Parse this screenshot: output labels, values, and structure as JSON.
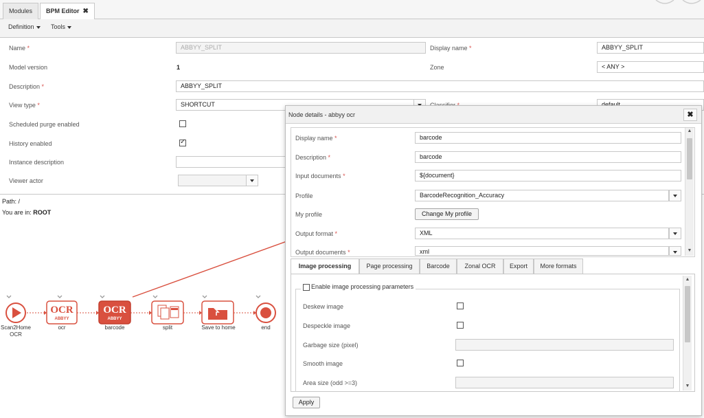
{
  "tabs": [
    {
      "label": "Modules"
    },
    {
      "label": "BPM Editor",
      "close": "✖"
    }
  ],
  "toolbar": {
    "definition": "Definition",
    "tools": "Tools"
  },
  "form": {
    "name_label": "Name",
    "name_value": "ABBYY_SPLIT",
    "display_name_label": "Display name",
    "display_name_value": "ABBYY_SPLIT",
    "model_version_label": "Model version",
    "model_version_value": "1",
    "zone_label": "Zone",
    "zone_value": "< ANY >",
    "description_label": "Description",
    "description_value": "ABBYY_SPLIT",
    "view_type_label": "View type",
    "view_type_value": "SHORTCUT",
    "classifier_label": "Classifier",
    "classifier_value": "default",
    "scheduled_purge_label": "Scheduled purge enabled",
    "scheduled_purge_checked": false,
    "history_label": "History enabled",
    "history_checked": true,
    "instance_description_label": "Instance description",
    "viewer_actor_label": "Viewer actor",
    "required_mark": "*"
  },
  "path": {
    "path_text": "Path: /",
    "you_are_in_label": "You are in:",
    "you_are_in_value": "ROOT"
  },
  "flow": {
    "nodes": [
      {
        "label": "Scan2Home OCR",
        "icon": "play-start-icon"
      },
      {
        "label": "ocr",
        "icon": "abbyy-ocr-icon",
        "title": "OCR",
        "sub": "ABBYY"
      },
      {
        "label": "barcode",
        "icon": "abbyy-ocr-icon",
        "title": "OCR",
        "sub": "ABBYY",
        "selected": true
      },
      {
        "label": "split",
        "icon": "split-document-icon"
      },
      {
        "label": "Save to home",
        "icon": "save-folder-icon"
      },
      {
        "label": "end",
        "icon": "stop-end-icon"
      }
    ],
    "accent_color": "#d9503f"
  },
  "dialog": {
    "title": "Node details - abbyy ocr",
    "close": "✖",
    "display_name_label": "Display name",
    "display_name_value": "barcode",
    "description_label": "Description",
    "description_value": "barcode",
    "input_documents_label": "Input documents",
    "input_documents_value": "${document}",
    "profile_label": "Profile",
    "profile_value": "BarcodeRecognition_Accuracy",
    "my_profile_label": "My profile",
    "change_profile_button": "Change My profile",
    "output_format_label": "Output format",
    "output_format_value": "XML",
    "output_documents_label": "Output documents",
    "output_documents_value": "xml",
    "inner_tabs": [
      "Image processing",
      "Page processing",
      "Barcode",
      "Zonal OCR",
      "Export",
      "More formats"
    ],
    "enable_image_processing_label": "Enable image processing parameters",
    "deskew_label": "Deskew image",
    "despeckle_label": "Despeckle image",
    "garbage_size_label": "Garbage size (pixel)",
    "smooth_label": "Smooth image",
    "area_size_label": "Area size (odd >=3)",
    "apply_button": "Apply"
  }
}
